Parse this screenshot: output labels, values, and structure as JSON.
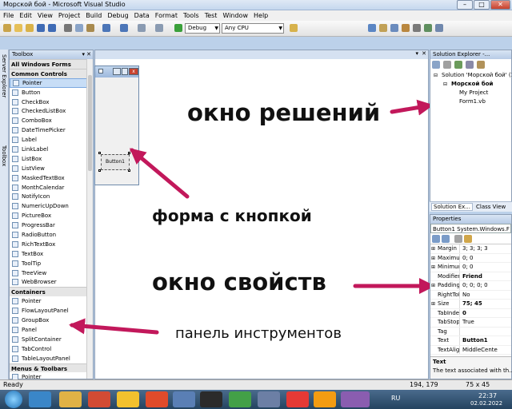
{
  "window": {
    "title": "Морской бой - Microsoft Visual Studio"
  },
  "menu": [
    "File",
    "Edit",
    "View",
    "Project",
    "Build",
    "Debug",
    "Data",
    "Format",
    "Tools",
    "Test",
    "Window",
    "Help"
  ],
  "toolbar": {
    "config": "Debug",
    "platform": "Any CPU"
  },
  "side_tabs": {
    "server_explorer": "Server Explorer",
    "toolbox": "Toolbox"
  },
  "toolbox": {
    "title": "Toolbox",
    "items": [
      {
        "t": "g",
        "label": "All Windows Forms"
      },
      {
        "t": "g",
        "label": "Common Controls"
      },
      {
        "t": "i",
        "label": "Pointer",
        "selected": true
      },
      {
        "t": "i",
        "label": "Button"
      },
      {
        "t": "i",
        "label": "CheckBox"
      },
      {
        "t": "i",
        "label": "CheckedListBox"
      },
      {
        "t": "i",
        "label": "ComboBox"
      },
      {
        "t": "i",
        "label": "DateTimePicker"
      },
      {
        "t": "i",
        "label": "Label"
      },
      {
        "t": "i",
        "label": "LinkLabel"
      },
      {
        "t": "i",
        "label": "ListBox"
      },
      {
        "t": "i",
        "label": "ListView"
      },
      {
        "t": "i",
        "label": "MaskedTextBox"
      },
      {
        "t": "i",
        "label": "MonthCalendar"
      },
      {
        "t": "i",
        "label": "NotifyIcon"
      },
      {
        "t": "i",
        "label": "NumericUpDown"
      },
      {
        "t": "i",
        "label": "PictureBox"
      },
      {
        "t": "i",
        "label": "ProgressBar"
      },
      {
        "t": "i",
        "label": "RadioButton"
      },
      {
        "t": "i",
        "label": "RichTextBox"
      },
      {
        "t": "i",
        "label": "TextBox"
      },
      {
        "t": "i",
        "label": "ToolTip"
      },
      {
        "t": "i",
        "label": "TreeView"
      },
      {
        "t": "i",
        "label": "WebBrowser"
      },
      {
        "t": "g",
        "label": "Containers"
      },
      {
        "t": "i",
        "label": "Pointer"
      },
      {
        "t": "i",
        "label": "FlowLayoutPanel"
      },
      {
        "t": "i",
        "label": "GroupBox"
      },
      {
        "t": "i",
        "label": "Panel"
      },
      {
        "t": "i",
        "label": "SplitContainer"
      },
      {
        "t": "i",
        "label": "TabControl"
      },
      {
        "t": "i",
        "label": "TableLayoutPanel"
      },
      {
        "t": "g",
        "label": "Menus & Toolbars"
      },
      {
        "t": "i",
        "label": "Pointer"
      }
    ]
  },
  "designer": {
    "button_text": "Button1"
  },
  "annotations": {
    "solution": "окно решений",
    "form": "форма с кнопкой",
    "properties": "окно свойств",
    "toolbox": "панель инструментов"
  },
  "solution_explorer": {
    "title": "Solution Explorer -...",
    "tree": [
      "Solution 'Морской бой' (1",
      "Морской бой",
      "My Project",
      "Form1.vb"
    ],
    "tabs": [
      "Solution Ex...",
      "Class View"
    ]
  },
  "properties": {
    "title": "Properties",
    "object": "Button1 System.Windows.F",
    "rows": [
      {
        "name": "Margin",
        "value": "3; 3; 3; 3",
        "exp": true
      },
      {
        "name": "MaximumSi",
        "value": "0; 0",
        "exp": true
      },
      {
        "name": "MinimumSi",
        "value": "0; 0",
        "exp": true
      },
      {
        "name": "Modifiers",
        "value": "Friend",
        "bold": true
      },
      {
        "name": "Padding",
        "value": "0; 0; 0; 0",
        "exp": true
      },
      {
        "name": "RightToLeft",
        "value": "No"
      },
      {
        "name": "Size",
        "value": "75; 45",
        "bold": true,
        "exp": true
      },
      {
        "name": "TabIndex",
        "value": "0",
        "bold": true
      },
      {
        "name": "TabStop",
        "value": "True"
      },
      {
        "name": "Tag",
        "value": ""
      },
      {
        "name": "Text",
        "value": "Button1",
        "bold": true
      },
      {
        "name": "TextAlign",
        "value": "MiddleCente"
      }
    ],
    "desc_title": "Text",
    "desc_text": "The text associated with th..."
  },
  "statusbar": {
    "left": "Ready",
    "pos": "194, 179",
    "size": "75 x 45"
  },
  "tray": {
    "lang": "RU",
    "time": "22:37",
    "date": "02.02.2022"
  }
}
